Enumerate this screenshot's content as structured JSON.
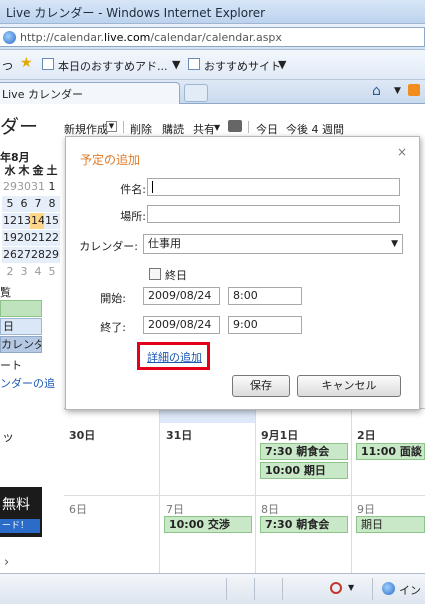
{
  "window": {
    "title": "Live カレンダー - Windows Internet Explorer"
  },
  "address": {
    "url_prefix": "http://calendar.",
    "url_domain": "live.com",
    "url_suffix": "/calendar/calendar.aspx"
  },
  "favorites": {
    "partial_left": "つ",
    "items": [
      "本日のおすすめアド...",
      "おすすめサイト"
    ]
  },
  "tab": {
    "label": "Live カレンダー"
  },
  "sidebar": {
    "brand": "ダー",
    "month": "年8月",
    "weekdays": [
      "水",
      "木",
      "金",
      "土"
    ],
    "weeks": [
      [
        "29",
        "30",
        "31",
        "1"
      ],
      [
        "5",
        "6",
        "7",
        "8"
      ],
      [
        "12",
        "13",
        "14",
        "15"
      ],
      [
        "19",
        "20",
        "21",
        "22"
      ],
      [
        "26",
        "27",
        "28",
        "29"
      ],
      [
        "2",
        "3",
        "4",
        "5"
      ]
    ],
    "today": "14",
    "section": "覧",
    "items": [
      "日",
      "カレンダー",
      "ート",
      "ンダーの追"
    ],
    "partial": "ッ",
    "ad_text": "無料",
    "ad_button": "ード！",
    "chevron": "›"
  },
  "toolbar": {
    "new": "新規作成",
    "delete": "削除",
    "subscribe": "購読",
    "share": "共有",
    "today": "今日",
    "upcoming": "今後 4 週間"
  },
  "dialog": {
    "title": "予定の追加",
    "close": "×",
    "subject_label": "件名:",
    "location_label": "場所:",
    "calendar_label": "カレンダー:",
    "calendar_value": "仕事用",
    "allday_label": "終日",
    "start_label": "開始:",
    "start_date": "2009/08/24",
    "start_time": "8:00",
    "end_label": "終了:",
    "end_date": "2009/08/24",
    "end_time": "9:00",
    "details_link": "詳細の追加",
    "save": "保存",
    "cancel": "キャンセル"
  },
  "grid": {
    "week1": [
      {
        "day": "30日",
        "events": []
      },
      {
        "day": "31日",
        "events": []
      },
      {
        "day": "9月1日",
        "events": [
          "7:30 朝食会",
          "10:00 期日"
        ]
      },
      {
        "day": "2日",
        "events": [
          "11:00 面談"
        ]
      }
    ],
    "week2": [
      {
        "day": "6日",
        "events": []
      },
      {
        "day": "7日",
        "events": [
          "10:00 交渉"
        ]
      },
      {
        "day": "8日",
        "events": [
          "7:30 朝食会"
        ]
      },
      {
        "day": "9日",
        "events": [
          "期日"
        ]
      }
    ]
  },
  "statusbar": {
    "zone": "イン"
  }
}
